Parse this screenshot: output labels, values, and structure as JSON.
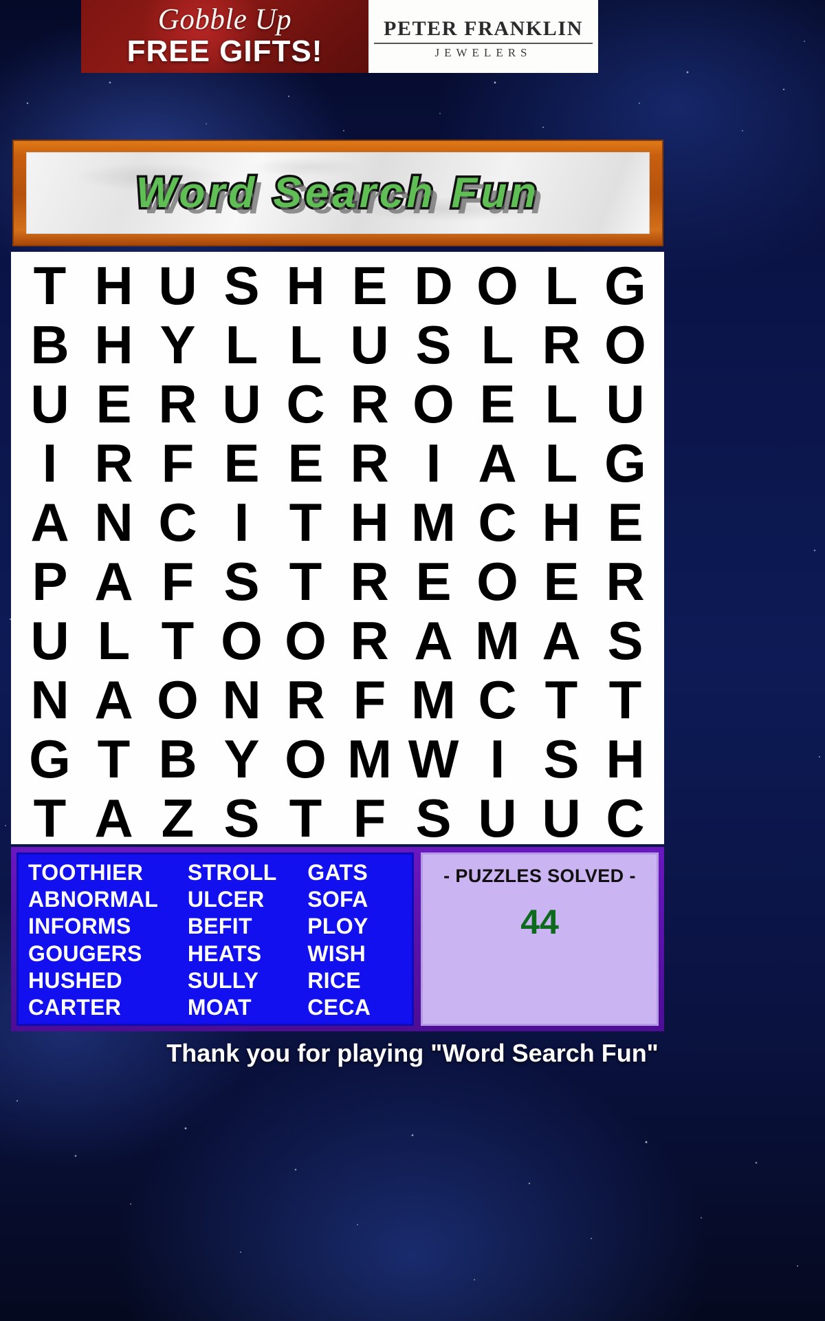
{
  "ad": {
    "headline_script": "Gobble Up",
    "headline_bold": "FREE GIFTS!",
    "brand_name": "PETER FRANKLIN",
    "brand_sub": "JEWELERS"
  },
  "title": {
    "text": "Word Search Fun"
  },
  "grid": {
    "rows": [
      [
        "T",
        "H",
        "U",
        "S",
        "H",
        "E",
        "D",
        "O",
        "L",
        "G"
      ],
      [
        "B",
        "H",
        "Y",
        "L",
        "L",
        "U",
        "S",
        "L",
        "R",
        "O"
      ],
      [
        "U",
        "E",
        "R",
        "U",
        "C",
        "R",
        "O",
        "E",
        "L",
        "U"
      ],
      [
        "I",
        "R",
        "F",
        "E",
        "E",
        "R",
        "I",
        "A",
        "L",
        "G"
      ],
      [
        "A",
        "N",
        "C",
        "I",
        "T",
        "H",
        "M",
        "C",
        "H",
        "E"
      ],
      [
        "P",
        "A",
        "F",
        "S",
        "T",
        "R",
        "E",
        "O",
        "E",
        "R"
      ],
      [
        "U",
        "L",
        "T",
        "O",
        "O",
        "R",
        "A",
        "M",
        "A",
        "S"
      ],
      [
        "N",
        "A",
        "O",
        "N",
        "R",
        "F",
        "M",
        "C",
        "T",
        "T"
      ],
      [
        "G",
        "T",
        "B",
        "Y",
        "O",
        "M",
        "W",
        "I",
        "S",
        "H"
      ],
      [
        "T",
        "A",
        "Z",
        "S",
        "T",
        "F",
        "S",
        "U",
        "U",
        "C"
      ]
    ]
  },
  "word_list": {
    "column1": [
      "TOOTHIER",
      "ABNORMAL",
      "INFORMS",
      "GOUGERS",
      "HUSHED",
      "CARTER"
    ],
    "column2": [
      "STROLL",
      "ULCER",
      "BEFIT",
      "HEATS",
      "SULLY",
      "MOAT"
    ],
    "column3": [
      "GATS",
      "SOFA",
      "PLOY",
      "WISH",
      "RICE",
      "CECA"
    ]
  },
  "solved": {
    "label": "- PUZZLES SOLVED -",
    "count": "44"
  },
  "footer": {
    "message": "Thank you for playing \"Word Search Fun\""
  },
  "colors": {
    "word_panel_bg": "#1310f0",
    "solved_panel_bg": "#cbb4f2",
    "solved_count": "#0e6b1e",
    "title_green": "#5fbf54",
    "frame_orange": "#c85f10"
  }
}
